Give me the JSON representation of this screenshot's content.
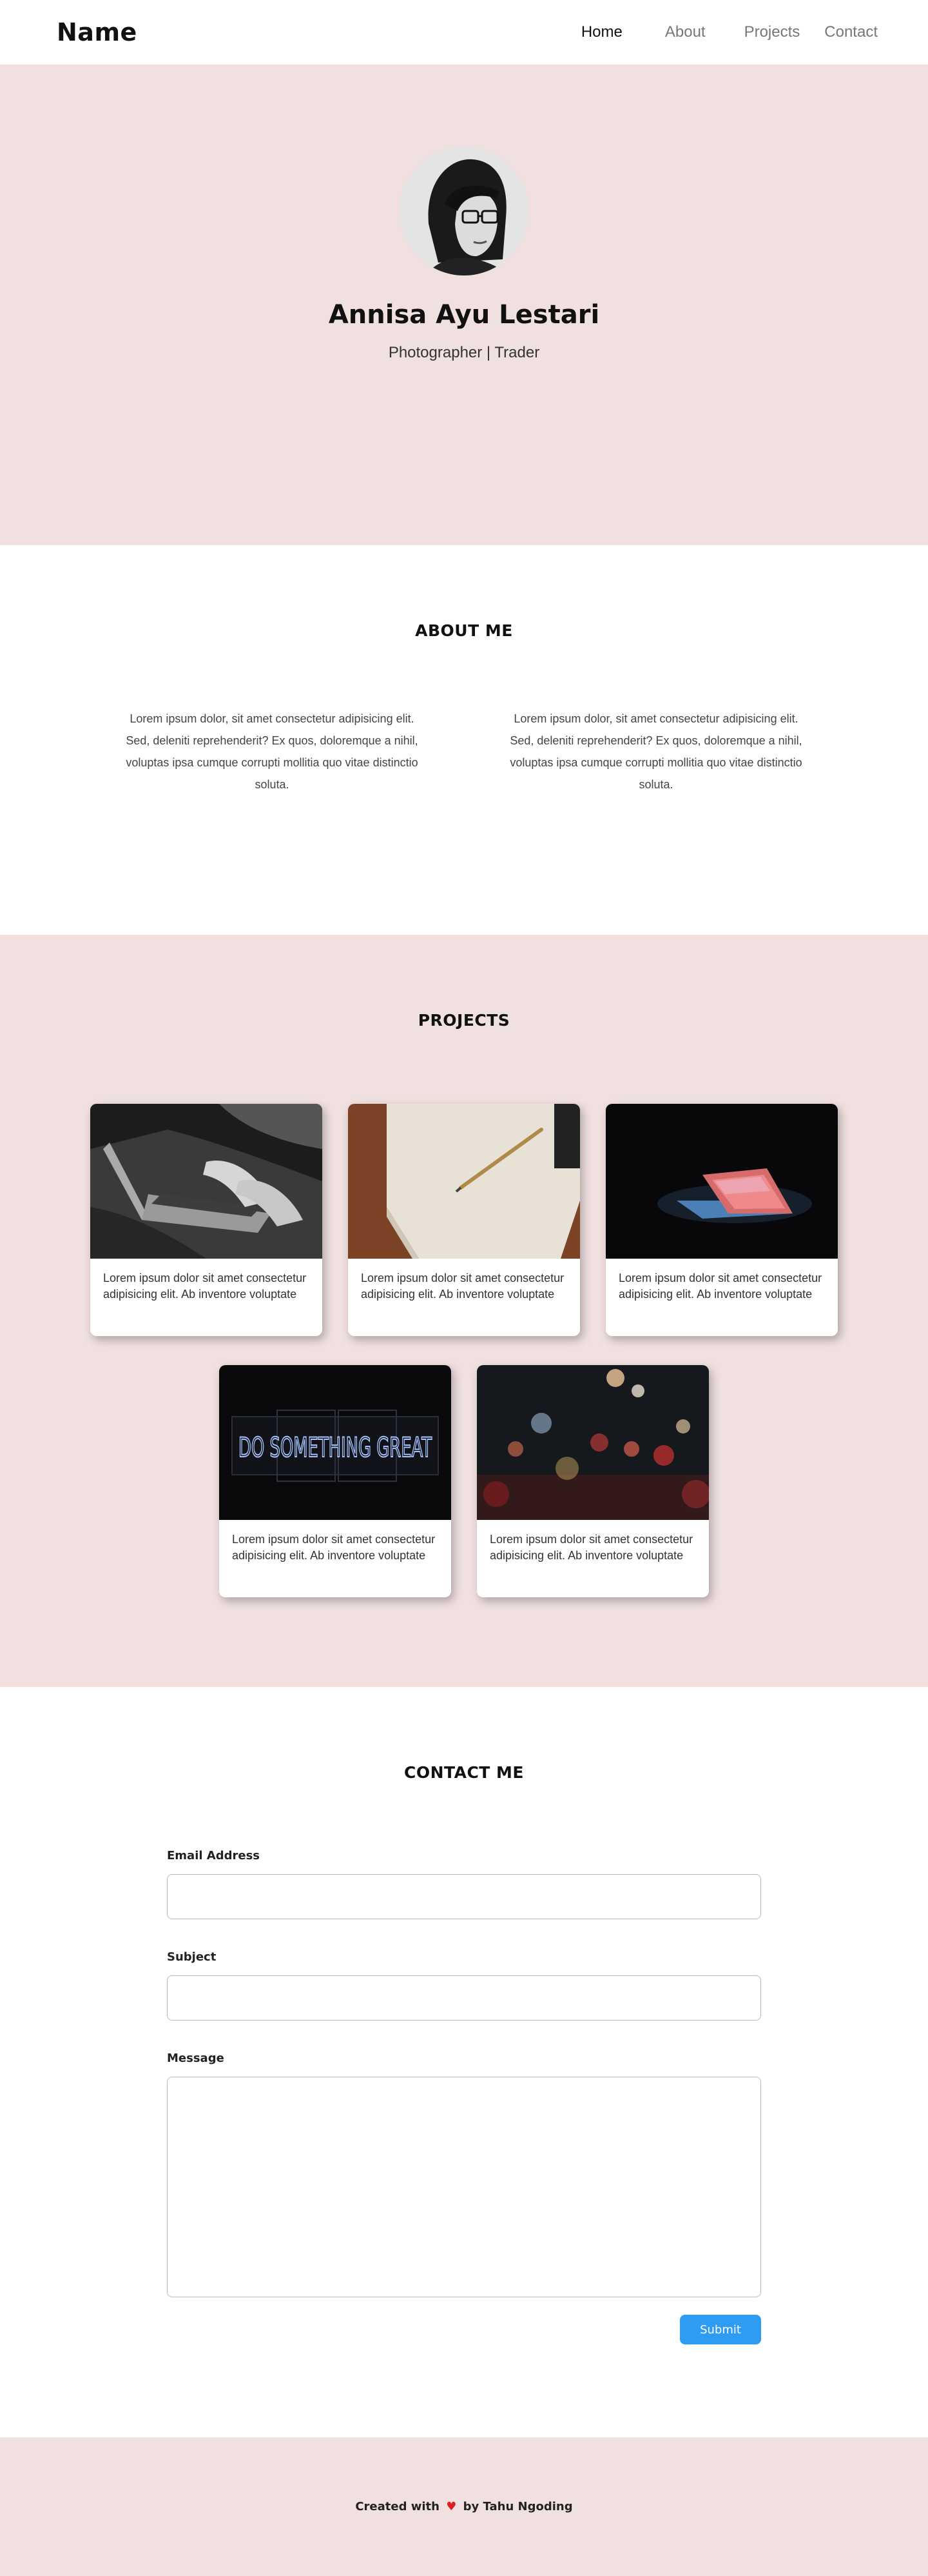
{
  "nav": {
    "brand": "Name",
    "links": [
      "Home",
      "About",
      "Projects",
      "Contact"
    ]
  },
  "hero": {
    "name": "Annisa Ayu Lestari",
    "role": "Photographer | Trader"
  },
  "about": {
    "title": "ABOUT ME",
    "paragraphs": [
      "Lorem ipsum dolor, sit amet consectetur adipisicing elit. Sed, deleniti reprehenderit? Ex quos, doloremque a nihil, voluptas ipsa cumque corrupti mollitia quo vitae distinctio soluta.",
      "Lorem ipsum dolor, sit amet consectetur adipisicing elit. Sed, deleniti reprehenderit? Ex quos, doloremque a nihil, voluptas ipsa cumque corrupti mollitia quo vitae distinctio soluta."
    ]
  },
  "projects": {
    "title": "PROJECTS",
    "cards": [
      {
        "image": "laptop-typing",
        "text": "Lorem ipsum dolor sit amet consectetur adipisicing elit. Ab inventore voluptate"
      },
      {
        "image": "notebook-pen",
        "text": "Lorem ipsum dolor sit amet consectetur adipisicing elit. Ab inventore voluptate"
      },
      {
        "image": "glowing-laptop",
        "text": "Lorem ipsum dolor sit amet consectetur adipisicing elit. Ab inventore voluptate"
      },
      {
        "image": "neon-sign",
        "sign_text": "DO SOMETHING GREAT",
        "text": "Lorem ipsum dolor sit amet consectetur adipisicing elit. Ab inventore voluptate"
      },
      {
        "image": "city-bokeh",
        "text": "Lorem ipsum dolor sit amet consectetur adipisicing elit. Ab inventore voluptate"
      }
    ]
  },
  "contact": {
    "title": "CONTACT ME",
    "email_label": "Email Address",
    "subject_label": "Subject",
    "message_label": "Message",
    "submit_label": "Submit"
  },
  "footer": {
    "prefix": "Created with",
    "suffix": "by Tahu Ngoding"
  },
  "colors": {
    "section_bg": "#f0e0e0",
    "accent": "#2d9cf2",
    "heart": "#e02020"
  }
}
